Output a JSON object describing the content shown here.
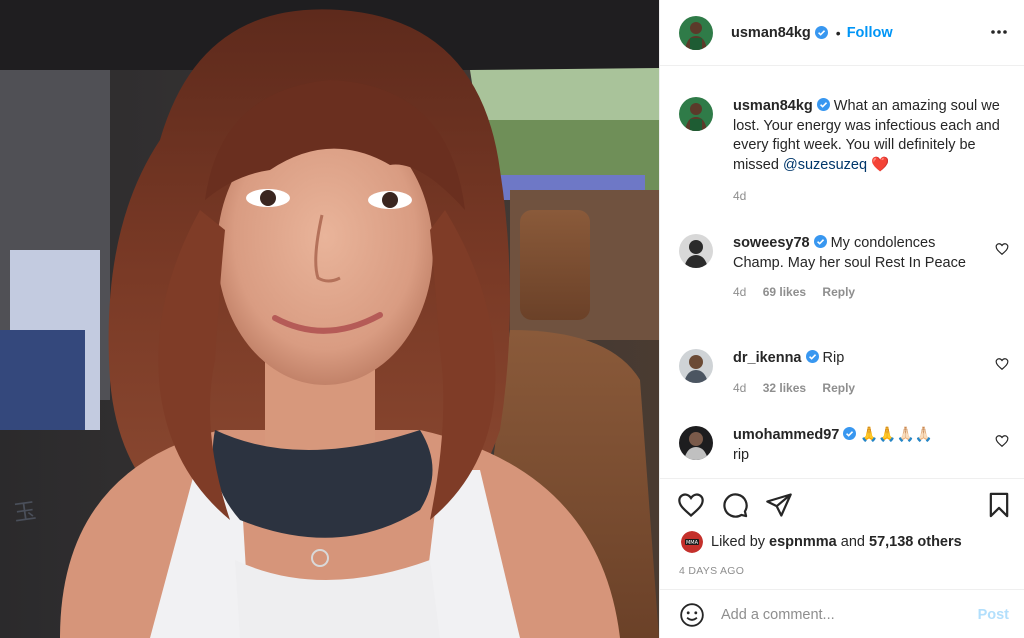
{
  "post": {
    "image_alt": "Selfie of a smiling woman with auburn wavy hair and bangs in a car",
    "author": "usman84kg",
    "follow_label": "Follow",
    "separator": "•",
    "more_icon": "more-options-icon"
  },
  "caption": {
    "username": "usman84kg",
    "text": "What an amazing soul we lost. Your energy was infectious each and every fight week. You will definitely be missed",
    "mention": "@suzesuzeq",
    "emoji": "❤️",
    "age": "4d"
  },
  "comments": [
    {
      "username": "soweesy78",
      "text": "My condolences Champ. May her soul Rest In Peace",
      "age": "4d",
      "likes": "69 likes",
      "reply": "Reply"
    },
    {
      "username": "dr_ikenna",
      "text": "Rip",
      "age": "4d",
      "likes": "32 likes",
      "reply": "Reply"
    },
    {
      "username": "umohammed97",
      "text": "🙏🙏🙏🏻🙏🏻",
      "text2": "rip"
    }
  ],
  "likes": {
    "prefix": "Liked by",
    "user": "espnmma",
    "conj": "and",
    "others": "57,138 others"
  },
  "timestamp": "4 DAYS AGO",
  "add_comment": {
    "placeholder": "Add a comment...",
    "post_label": "Post"
  },
  "colors": {
    "link": "#0095f6",
    "verified": "#3897f0",
    "heart": "#ed4956",
    "muted": "#8e8e8e"
  }
}
